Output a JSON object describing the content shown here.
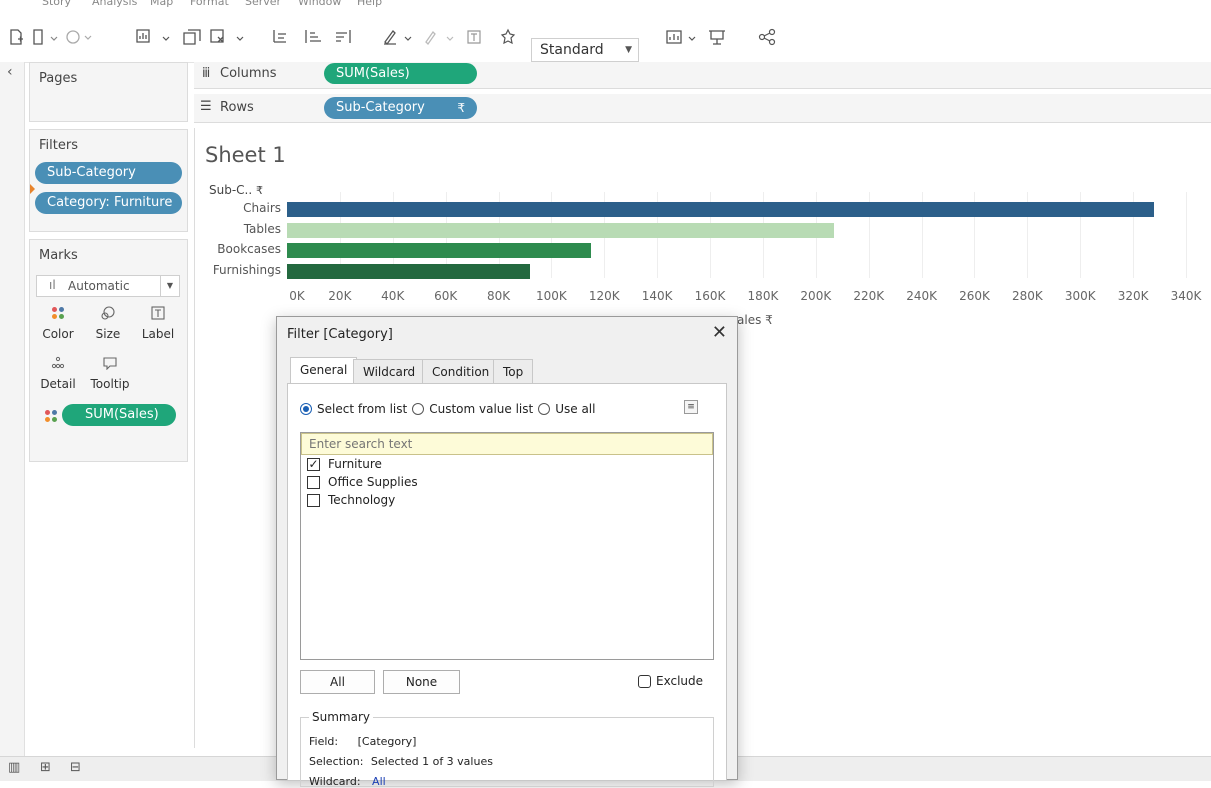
{
  "menu": [
    "Story",
    "Analysis",
    "Map",
    "Format",
    "Server",
    "Window",
    "Help"
  ],
  "toolbar": {
    "fit_value": "Standard"
  },
  "shelves": {
    "pages_label": "Pages",
    "columns_label": "Columns",
    "columns_pill": "SUM(Sales)",
    "rows_label": "Rows",
    "rows_pill": "Sub-Category"
  },
  "filters": {
    "title": "Filters",
    "pills": [
      "Sub-Category",
      "Category: Furniture"
    ]
  },
  "marks": {
    "title": "Marks",
    "type_value": "Automatic",
    "buttons": [
      "Color",
      "Size",
      "Label",
      "Detail",
      "Tooltip"
    ],
    "measure_pill": "SUM(Sales)"
  },
  "sheet": {
    "title": "Sheet 1",
    "row_header": "Sub-C..",
    "axis_title_partial": "ales"
  },
  "chart_data": {
    "type": "bar",
    "orientation": "horizontal",
    "categories": [
      "Chairs",
      "Tables",
      "Bookcases",
      "Furnishings"
    ],
    "values": [
      328000,
      207000,
      115000,
      92000
    ],
    "colors": [
      "#2c5f8a",
      "#b8dbb4",
      "#2e8b4e",
      "#23693f"
    ],
    "xlim": [
      0,
      340000
    ],
    "xticks": [
      "0K",
      "20K",
      "40K",
      "60K",
      "80K",
      "100K",
      "120K",
      "140K",
      "160K",
      "180K",
      "200K",
      "220K",
      "240K",
      "260K",
      "280K",
      "300K",
      "320K",
      "340K"
    ],
    "grid": true
  },
  "dialog": {
    "title": "Filter [Category]",
    "tabs": [
      "General",
      "Wildcard",
      "Condition",
      "Top"
    ],
    "radio_options": [
      "Select from list",
      "Custom value list",
      "Use all"
    ],
    "search_placeholder": "Enter search text",
    "items": [
      {
        "label": "Furniture",
        "checked": true
      },
      {
        "label": "Office Supplies",
        "checked": false
      },
      {
        "label": "Technology",
        "checked": false
      }
    ],
    "all_button": "All",
    "none_button": "None",
    "exclude_label": "Exclude",
    "summary": {
      "legend": "Summary",
      "field_label": "Field:",
      "field_value": "[Category]",
      "selection_label": "Selection:",
      "selection_value": "Selected 1 of 3 values",
      "wildcard_label": "Wildcard:",
      "wildcard_value": "All"
    }
  }
}
